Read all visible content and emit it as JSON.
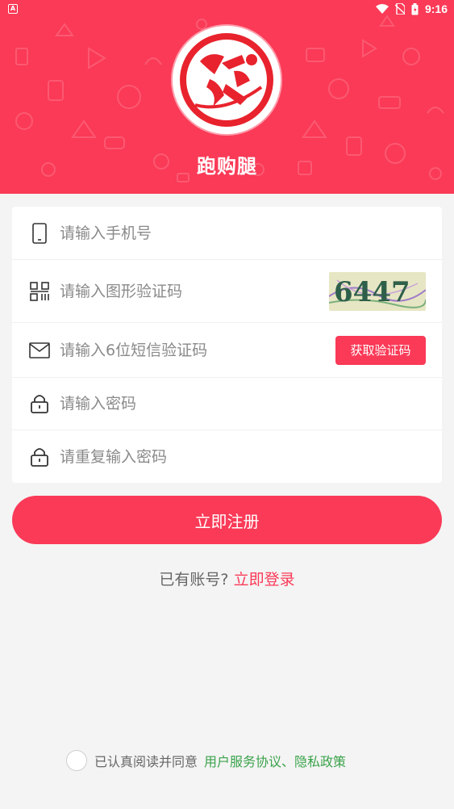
{
  "status_bar": {
    "left_icon": "A",
    "time": "9:16",
    "icons": [
      "wifi-icon",
      "no-sim-icon",
      "battery-icon"
    ]
  },
  "header": {
    "app_name": "跑购腿",
    "background_color": "#fa3a57",
    "logo": "running-man-logo"
  },
  "form": {
    "phone": {
      "placeholder": "请输入手机号",
      "icon": "phone-icon"
    },
    "captcha": {
      "placeholder": "请输入图形验证码",
      "icon": "qrcode-icon",
      "image_text": "6447"
    },
    "sms": {
      "placeholder": "请输入6位短信验证码",
      "icon": "mail-icon",
      "button_label": "获取验证码"
    },
    "password": {
      "placeholder": "请输入密码",
      "icon": "lock-icon"
    },
    "password_confirm": {
      "placeholder": "请重复输入密码",
      "icon": "lock-icon"
    }
  },
  "register_button": "立即注册",
  "login": {
    "prompt": "已有账号?",
    "link": "立即登录"
  },
  "agreement": {
    "text": "已认真阅读并同意",
    "links": "用户服务协议、隐私政策",
    "checked": false
  },
  "colors": {
    "accent": "#fa3a57",
    "link_green": "#3aa34a"
  }
}
